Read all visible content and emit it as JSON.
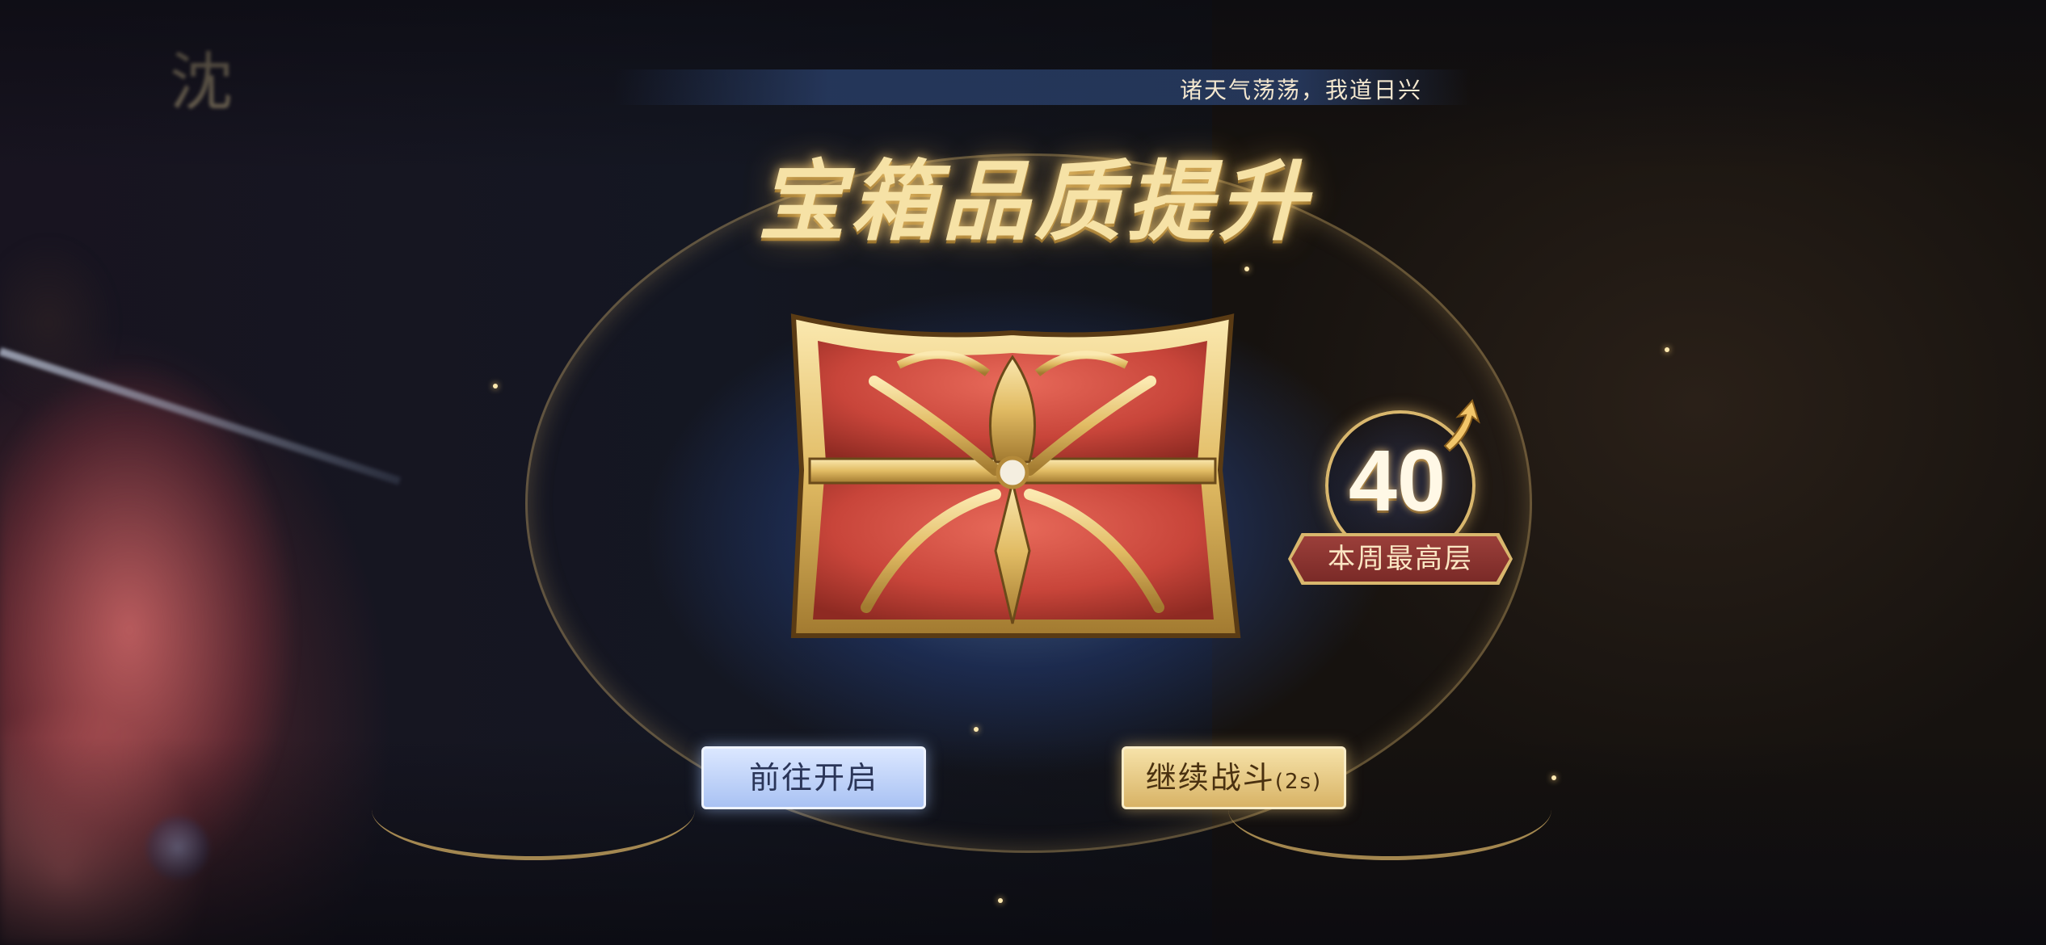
{
  "banner": {
    "text": "诸天气荡荡，我道日兴"
  },
  "title": "宝箱品质提升",
  "character": {
    "name": "沈"
  },
  "floor": {
    "number": "40",
    "label": "本周最高层"
  },
  "buttons": {
    "open_label": "前往开启",
    "continue_label": "继续战斗",
    "continue_timer": "(2s)"
  },
  "colors": {
    "gold": "#d9b76d",
    "chest_red": "#c8453a",
    "open_button": "#a9c2f3",
    "continue_button": "#d8b366",
    "label_red": "#7a2a27"
  },
  "icons": [
    "treasure-chest-icon",
    "up-arrow-icon"
  ]
}
